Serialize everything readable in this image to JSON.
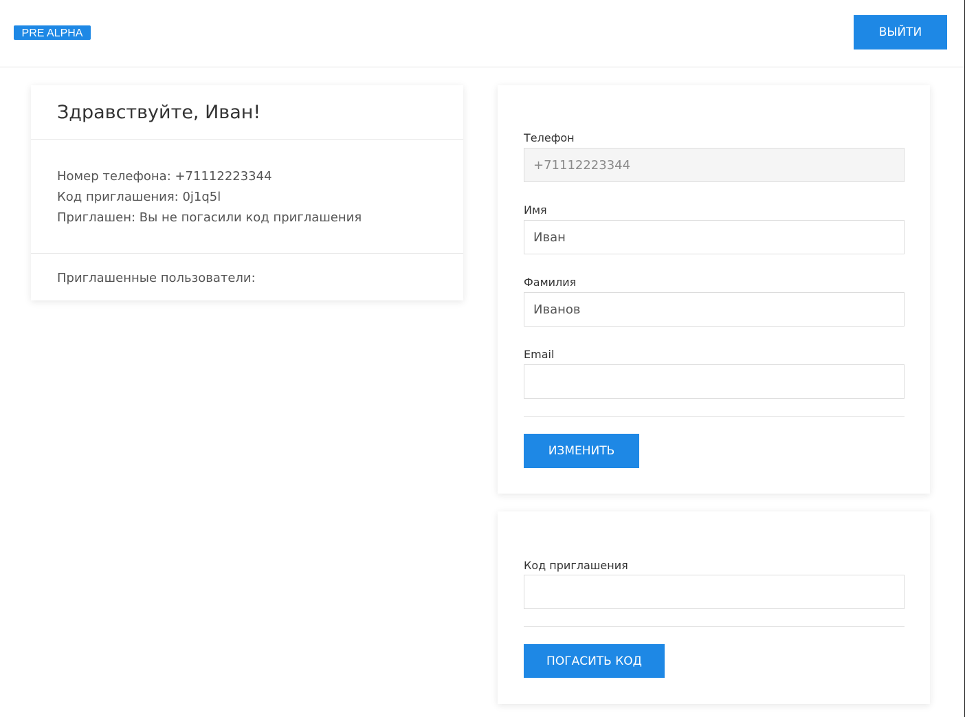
{
  "header": {
    "badge": "PRE ALPHA",
    "logout_label": "ВЫЙТИ"
  },
  "profile": {
    "greeting": "Здравствуйте, Иван!",
    "phone_line": "Номер телефона: +71112223344",
    "invite_code_line": "Код приглашения: 0j1q5l",
    "invited_line": "Приглашен: Вы не погасили код приглашения",
    "invited_users_label": "Приглашенные пользователи:"
  },
  "edit_form": {
    "phone_label": "Телефон",
    "phone_value": "+71112223344",
    "first_name_label": "Имя",
    "first_name_value": "Иван",
    "last_name_label": "Фамилия",
    "last_name_value": "Иванов",
    "email_label": "Email",
    "email_value": "",
    "submit_label": "ИЗМЕНИТЬ"
  },
  "invite_form": {
    "code_label": "Код приглашения",
    "code_value": "",
    "submit_label": "ПОГАСИТЬ КОД"
  },
  "colors": {
    "accent": "#1e88e5",
    "readonly_bg": "#f5f5f5"
  }
}
